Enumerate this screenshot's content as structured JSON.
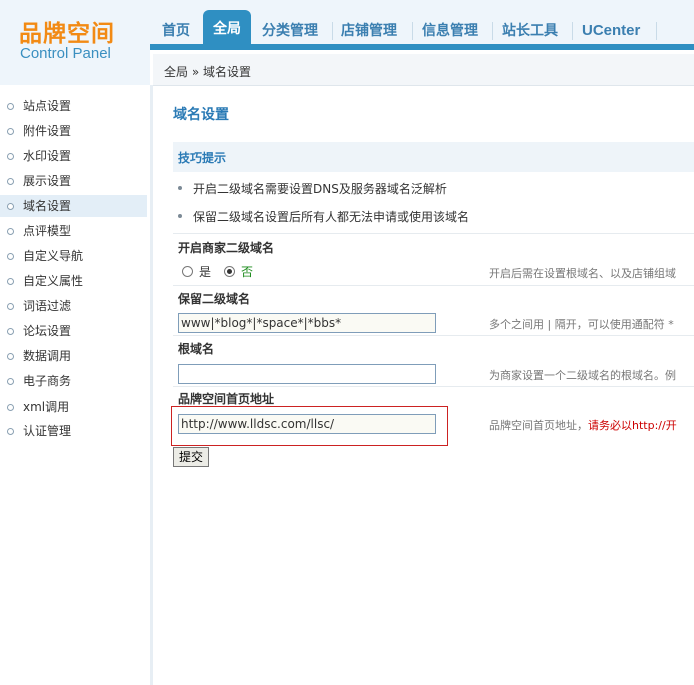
{
  "logo": {
    "title": "品牌空间",
    "subtitle": "Control Panel"
  },
  "topnav": {
    "tabs": [
      {
        "label": "首页"
      },
      {
        "label": "全局"
      },
      {
        "label": "分类管理"
      },
      {
        "label": "店铺管理"
      },
      {
        "label": "信息管理"
      },
      {
        "label": "站长工具"
      },
      {
        "label": "UCenter"
      }
    ]
  },
  "breadcrumb": "全局 » 域名设置",
  "sidebar": {
    "items": [
      {
        "label": "站点设置"
      },
      {
        "label": "附件设置"
      },
      {
        "label": "水印设置"
      },
      {
        "label": "展示设置"
      },
      {
        "label": "域名设置"
      },
      {
        "label": "点评模型"
      },
      {
        "label": "自定义导航"
      },
      {
        "label": "自定义属性"
      },
      {
        "label": "词语过滤"
      },
      {
        "label": "论坛设置"
      },
      {
        "label": "数据调用"
      },
      {
        "label": "电子商务"
      },
      {
        "label": "xml调用"
      },
      {
        "label": "认证管理"
      }
    ]
  },
  "main": {
    "title": "域名设置",
    "tips": {
      "title": "技巧提示",
      "items": [
        "开启二级域名需要设置DNS及服务器域名泛解析",
        "保留二级域名设置后所有人都无法申请或使用该域名"
      ]
    },
    "fields": {
      "subdomain": {
        "title": "开启商家二级域名",
        "yes": "是",
        "no": "否",
        "help": "开启后需在设置根域名、以及店铺组域"
      },
      "reserved": {
        "title": "保留二级域名",
        "value": "www|*blog*|*space*|*bbs*",
        "help": "多个之间用 | 隔开，可以使用通配符 *"
      },
      "root": {
        "title": "根域名",
        "value": "",
        "help": "为商家设置一个二级域名的根域名。例"
      },
      "homepage": {
        "title": "品牌空间首页地址",
        "value": "http://www.lldsc.com/llsc/",
        "help": "品牌空间首页地址，",
        "help_warn": "请务必以http://开"
      }
    },
    "submit_label": "提交"
  }
}
